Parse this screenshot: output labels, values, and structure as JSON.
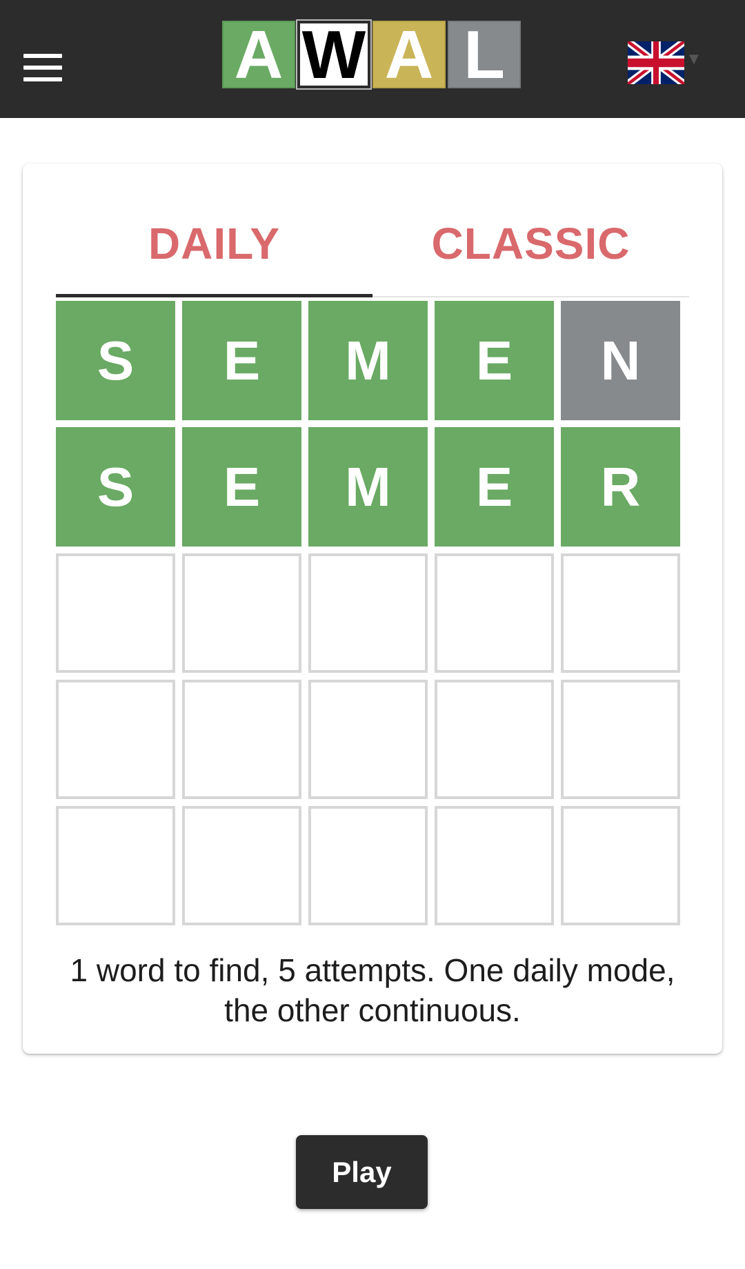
{
  "header": {
    "menu_icon": "hamburger-menu-icon",
    "logo": [
      {
        "letter": "A",
        "state": "green"
      },
      {
        "letter": "W",
        "state": "white"
      },
      {
        "letter": "A",
        "state": "yellow"
      },
      {
        "letter": "L",
        "state": "gray"
      }
    ],
    "language_icon": "uk-flag-icon",
    "language_caret_icon": "caret-down-icon"
  },
  "tabs": [
    {
      "label": "DAILY",
      "active": true
    },
    {
      "label": "CLASSIC",
      "active": false
    }
  ],
  "board": {
    "rows": [
      [
        {
          "letter": "S",
          "state": "correct"
        },
        {
          "letter": "E",
          "state": "correct"
        },
        {
          "letter": "M",
          "state": "correct"
        },
        {
          "letter": "E",
          "state": "correct"
        },
        {
          "letter": "N",
          "state": "absent"
        }
      ],
      [
        {
          "letter": "S",
          "state": "correct"
        },
        {
          "letter": "E",
          "state": "correct"
        },
        {
          "letter": "M",
          "state": "correct"
        },
        {
          "letter": "E",
          "state": "correct"
        },
        {
          "letter": "R",
          "state": "correct"
        }
      ],
      [
        {
          "letter": "",
          "state": "empty"
        },
        {
          "letter": "",
          "state": "empty"
        },
        {
          "letter": "",
          "state": "empty"
        },
        {
          "letter": "",
          "state": "empty"
        },
        {
          "letter": "",
          "state": "empty"
        }
      ],
      [
        {
          "letter": "",
          "state": "empty"
        },
        {
          "letter": "",
          "state": "empty"
        },
        {
          "letter": "",
          "state": "empty"
        },
        {
          "letter": "",
          "state": "empty"
        },
        {
          "letter": "",
          "state": "empty"
        }
      ],
      [
        {
          "letter": "",
          "state": "empty"
        },
        {
          "letter": "",
          "state": "empty"
        },
        {
          "letter": "",
          "state": "empty"
        },
        {
          "letter": "",
          "state": "empty"
        },
        {
          "letter": "",
          "state": "empty"
        }
      ]
    ]
  },
  "description": "1 word to find, 5 attempts. One daily mode, the other continuous.",
  "play_label": "Play",
  "colors": {
    "header_bg": "#2c2c2c",
    "correct": "#6aaa64",
    "present": "#c9b458",
    "absent": "#878a8c",
    "tab_text": "#d9696c"
  }
}
